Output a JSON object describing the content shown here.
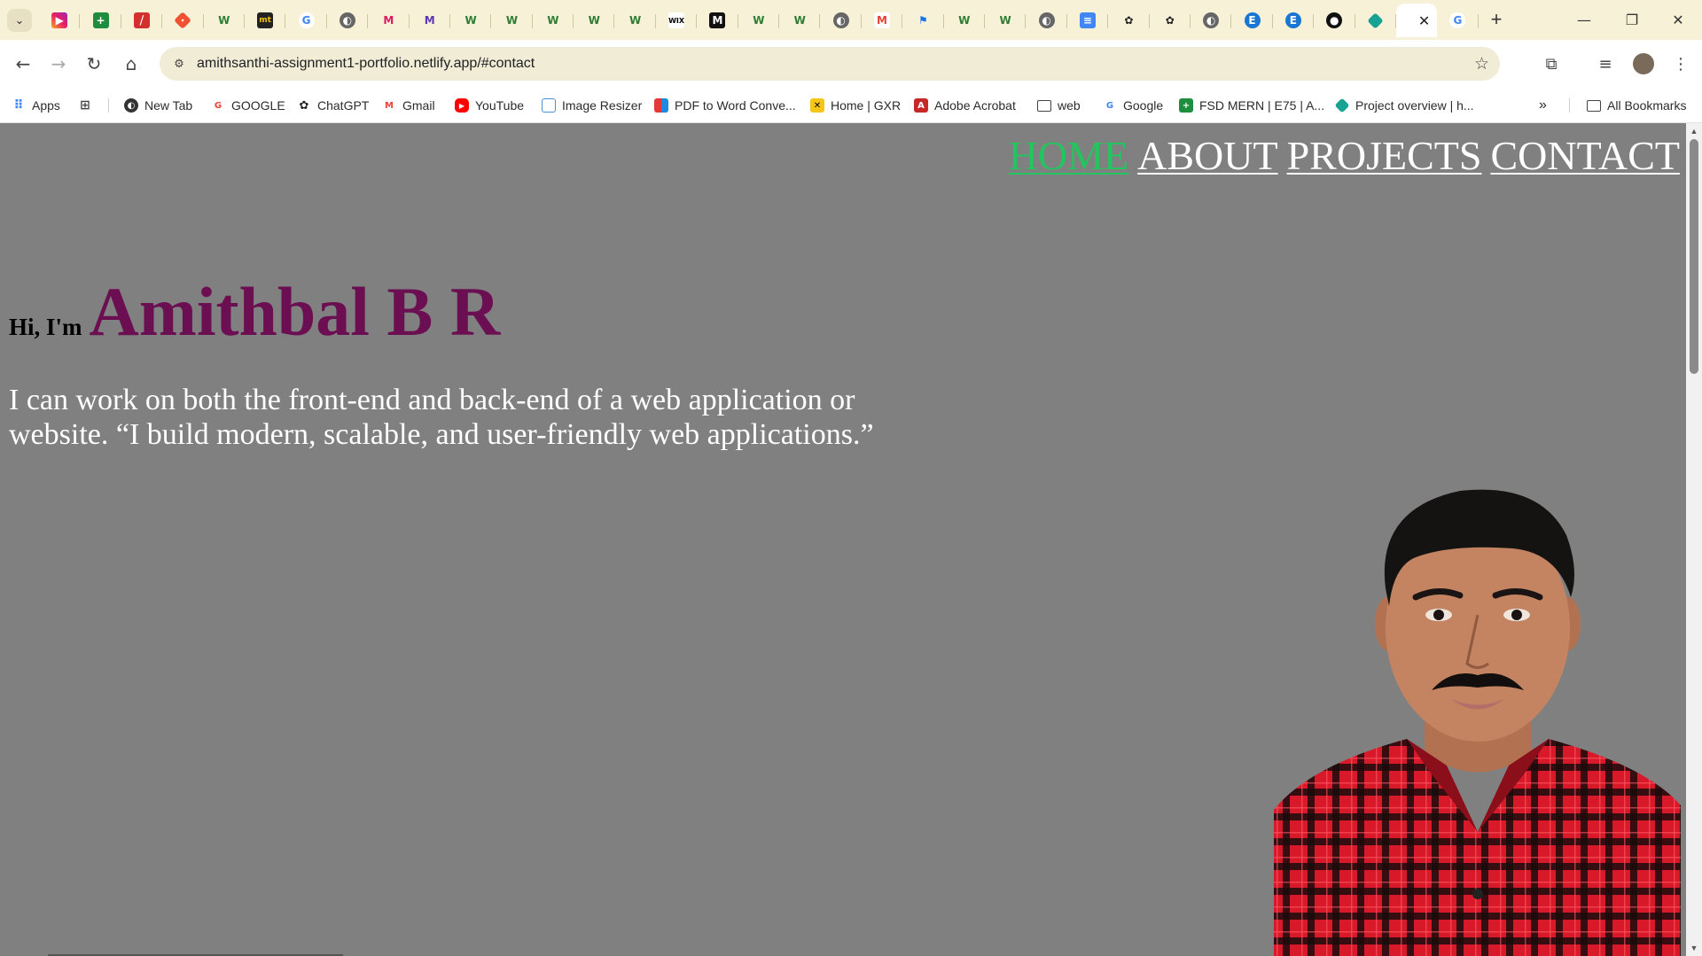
{
  "browser": {
    "tabs_count": 34,
    "tab_icons": [
      "instagram-reels-icon",
      "google-sheets-icon",
      "slides-icon",
      "git-icon",
      "w-icon",
      "mt-icon",
      "google-icon",
      "globe-icon",
      "m-icon",
      "m-icon",
      "w-icon",
      "w-icon",
      "w-icon",
      "w-icon",
      "w-icon",
      "wix-icon",
      "m-notion-icon",
      "w-icon",
      "w-icon",
      "globe-icon",
      "gmail-icon",
      "flag-icon",
      "w-icon",
      "w-icon",
      "globe-icon",
      "docs-icon",
      "openai-icon",
      "openai-icon",
      "globe-icon",
      "e-icon",
      "e-icon",
      "github-icon",
      "diamond-icon",
      "active-tab-icon",
      "google-icon"
    ],
    "address": {
      "url": "amithsanthi-assignment1-portfolio.netlify.app/#contact"
    },
    "bookmarks": [
      {
        "label": "Apps",
        "icon": "apps-grid-icon"
      },
      {
        "label": "",
        "icon": "tab-groups-icon"
      },
      {
        "label": "New Tab",
        "icon": "globe-icon"
      },
      {
        "label": "GOOGLE",
        "icon": "google-icon"
      },
      {
        "label": "ChatGPT",
        "icon": "openai-icon"
      },
      {
        "label": "Gmail",
        "icon": "gmail-icon"
      },
      {
        "label": "YouTube",
        "icon": "youtube-icon"
      },
      {
        "label": "Image Resizer",
        "icon": "image-resizer-icon"
      },
      {
        "label": "PDF to Word Conve...",
        "icon": "pdf-icon"
      },
      {
        "label": "Home | GXR",
        "icon": "gxr-icon"
      },
      {
        "label": "Adobe Acrobat",
        "icon": "acrobat-icon"
      },
      {
        "label": "web",
        "icon": "folder-icon"
      },
      {
        "label": "Google",
        "icon": "google-icon"
      },
      {
        "label": "FSD MERN | E75 | A...",
        "icon": "sheets-icon"
      },
      {
        "label": "Project overview | h...",
        "icon": "diamond-icon"
      }
    ],
    "all_bookmarks": "All Bookmarks"
  },
  "page": {
    "nav": [
      "HOME",
      "ABOUT",
      "PROJECTS",
      "CONTACT"
    ],
    "active_nav": "HOME",
    "greeting": "Hi, I'm",
    "name": "Amithbal B R",
    "tagline": "I can work on both the front-end and back-end of a web application or website. “I build modern, scalable, and user-friendly web applications.”",
    "colors": {
      "background": "#808080",
      "name": "#6b0f52",
      "nav_active": "#22c55e",
      "nav": "#ffffff"
    }
  }
}
